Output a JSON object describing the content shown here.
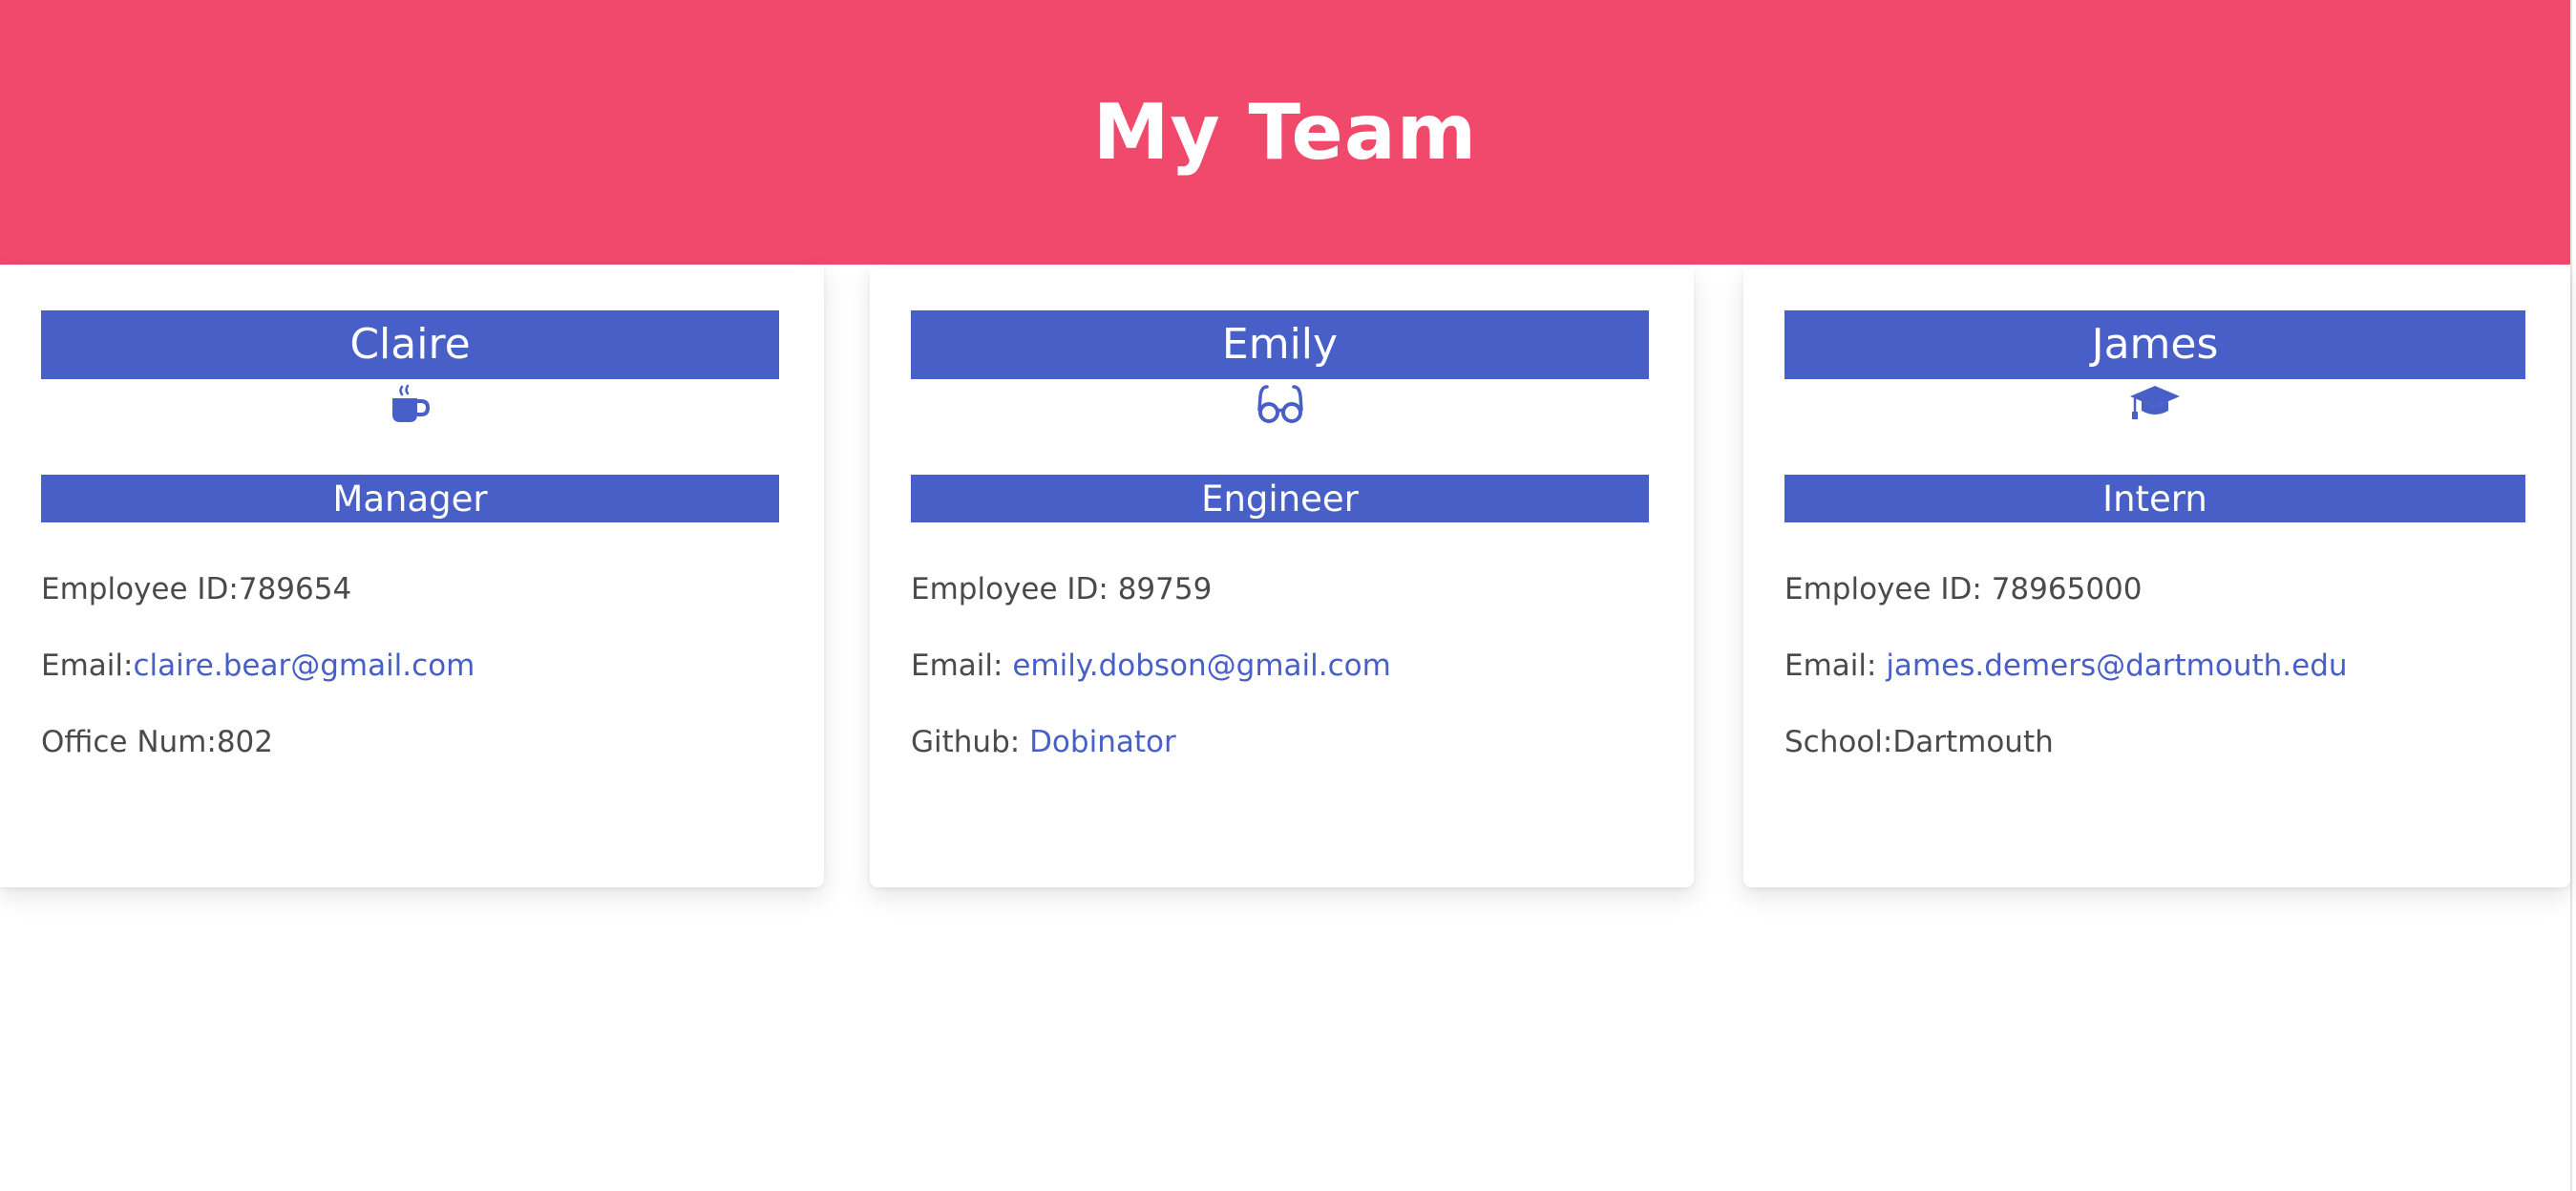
{
  "header": {
    "title": "My Team"
  },
  "colors": {
    "header_bg": "#f0496b",
    "accent": "#485fc7",
    "text": "#4a4a4a",
    "link": "#485fc7"
  },
  "team": [
    {
      "name": "Claire",
      "icon": "mug-icon",
      "role": "Manager",
      "id_label": "Employee ID:",
      "id_value": "789654",
      "email_label": "Email:",
      "email": "claire.bear@gmail.com",
      "extra_label": "Office Num:",
      "extra_value": "802"
    },
    {
      "name": "Emily",
      "icon": "glasses-icon",
      "role": "Engineer",
      "id_label": "Employee ID: ",
      "id_value": "89759",
      "email_label": "Email: ",
      "email": "emily.dobson@gmail.com",
      "extra_label": "Github: ",
      "extra_value": "Dobinator"
    },
    {
      "name": "James",
      "icon": "graduation-cap-icon",
      "role": "Intern",
      "id_label": "Employee ID: ",
      "id_value": "78965000",
      "email_label": "Email: ",
      "email": "james.demers@dartmouth.edu",
      "extra_label": "School:",
      "extra_value": "Dartmouth"
    }
  ]
}
